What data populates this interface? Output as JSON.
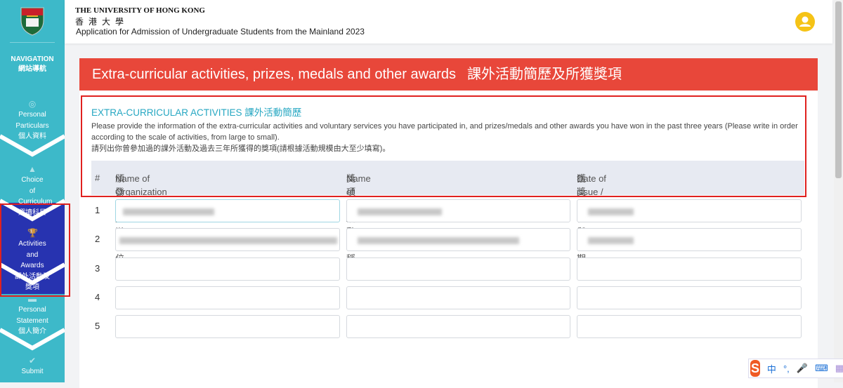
{
  "sidebar": {
    "nav_title": "NAVIGATION",
    "nav_title_zh": "網站導航",
    "items": [
      {
        "label": "Personal Particulars",
        "label_zh": "個人資料",
        "icon": "fingerprint-icon"
      },
      {
        "label": "Choice of Curriculum",
        "label_zh": "選讀科目",
        "icon": "graduation-cap-icon"
      },
      {
        "label": "Activities and Awards",
        "label_zh": "課外活動及獎項",
        "icon": "trophy-icon"
      },
      {
        "label": "Personal Statement",
        "label_zh": "個人簡介",
        "icon": "comment-icon"
      },
      {
        "label": "Submit",
        "label_zh": "",
        "icon": "check-circle-icon"
      }
    ]
  },
  "header": {
    "university_en": "THE UNIVERSITY OF HONG KONG",
    "university_zh": "香港大學",
    "subtitle": "Application for Admission of Undergraduate Students from the Mainland 2023"
  },
  "card": {
    "title_en": "Extra-curricular activities, prizes, medals and other awards",
    "title_zh": "課外活動簡歷及所獲獎項",
    "section_title": "EXTRA-CURRICULAR ACTIVITIES 課外活動簡歷",
    "description_en": "Please provide the information of the extra-curricular activities and voluntary services you have participated in, and prizes/medals and other awards you have won in the past three years (Please write in order according to the scale of activities, from large to small).",
    "description_zh": "請列出你曾參加過的課外活動及過去三年所獲得的獎項(請根據活動規模由大至少填寫)。",
    "columns": [
      {
        "en": "#",
        "zh": ""
      },
      {
        "en": "Name of Organization",
        "zh": "頒發 / 主辦單位"
      },
      {
        "en": "Name of award / activity",
        "zh": "獎項 / 活動名稱"
      },
      {
        "en": "Date of issue / participation",
        "zh": "獲獎 / 參與日期"
      }
    ],
    "rows": [
      "1",
      "2",
      "3",
      "4",
      "5"
    ]
  },
  "ime": {
    "lang": "中",
    "punct": "°,"
  },
  "colors": {
    "sidebar": "#3db9c9",
    "active": "#2733b0",
    "header_red": "#e8473a",
    "accent": "#26a7c2"
  }
}
